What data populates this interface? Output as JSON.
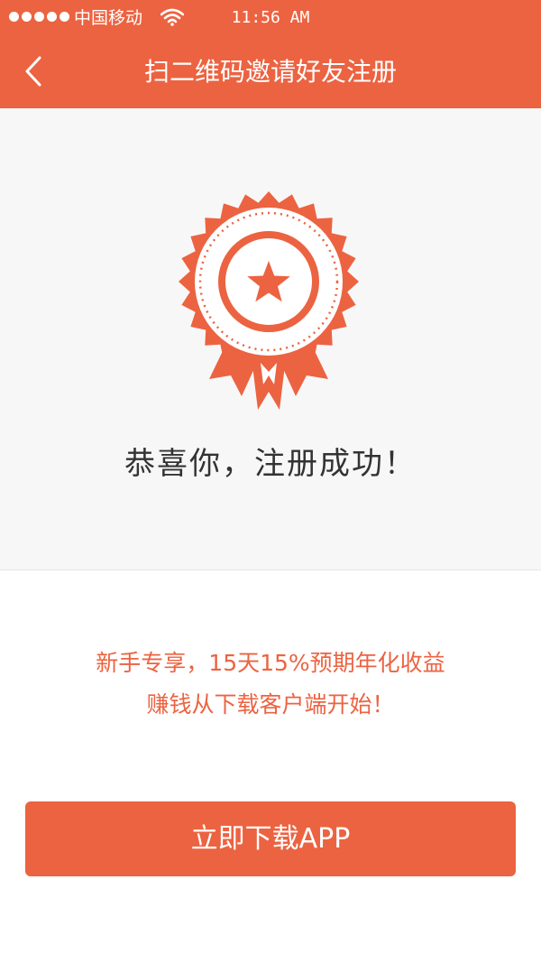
{
  "status_bar": {
    "carrier": "中国移动",
    "time": "11:56 AM",
    "signal_icon": "signal-dots-icon",
    "wifi_icon": "wifi-icon"
  },
  "nav": {
    "back_icon": "chevron-left-icon",
    "title": "扫二维码邀请好友注册"
  },
  "success": {
    "badge_icon": "award-ribbon-star-icon",
    "message": "恭喜你，注册成功！"
  },
  "promo": {
    "line1": "新手专享，15天15%预期年化收益",
    "line2": "赚钱从下载客户端开始！"
  },
  "download": {
    "label": "立即下载APP"
  },
  "colors": {
    "accent": "#ec6341",
    "panel_bg": "#f7f7f7",
    "text_dark": "#333333"
  }
}
